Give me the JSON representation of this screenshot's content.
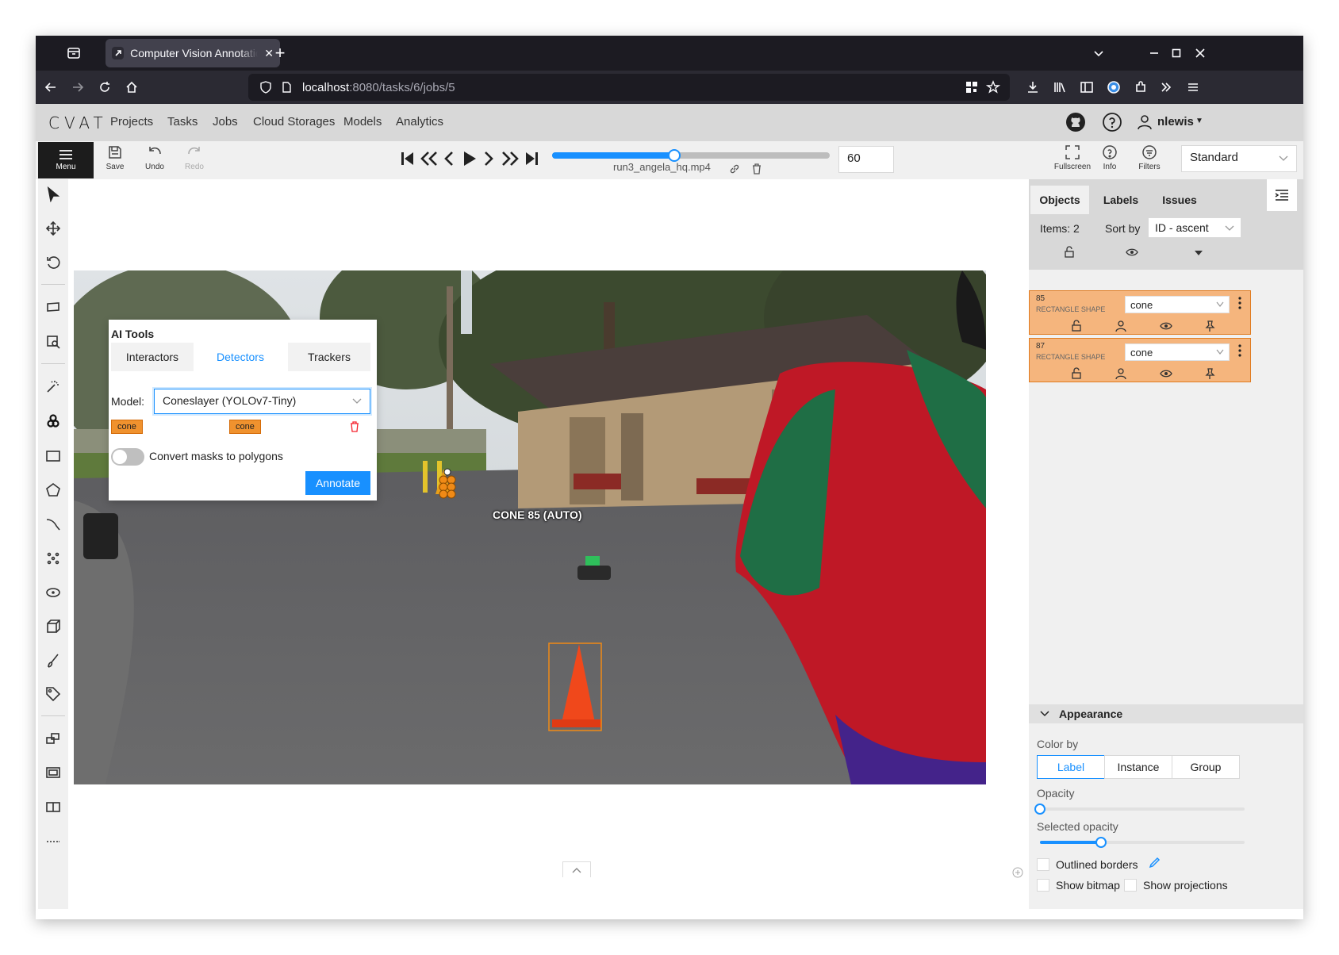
{
  "browser": {
    "tab_title": "Computer Vision Annotation Tool",
    "url_host": "localhost",
    "url_rest": ":8080/tasks/6/jobs/5"
  },
  "header": {
    "logo": "CVAT",
    "nav": [
      "Projects",
      "Tasks",
      "Jobs",
      "Cloud Storages",
      "Models",
      "Analytics"
    ],
    "username": "nlewis"
  },
  "toolbar": {
    "menu_label": "Menu",
    "save_label": "Save",
    "undo_label": "Undo",
    "redo_label": "Redo",
    "filename": "run3_angela_hq.mp4",
    "frame_number": "60",
    "frame_progress": 0.44,
    "fullscreen_label": "Fullscreen",
    "info_label": "Info",
    "filters_label": "Filters",
    "workspace": "Standard"
  },
  "canvas": {
    "cone_label": "CONE 85 (AUTO)"
  },
  "ai_tools": {
    "title": "AI Tools",
    "tabs": [
      "Interactors",
      "Detectors",
      "Trackers"
    ],
    "active_tab": "Detectors",
    "model_label": "Model:",
    "model_value": "Coneslayer (YOLOv7-Tiny)",
    "mapping_from": "cone",
    "mapping_to": "cone",
    "convert_label": "Convert masks to polygons",
    "convert_enabled": false,
    "annotate_label": "Annotate"
  },
  "sidebar": {
    "tabs": [
      "Objects",
      "Labels",
      "Issues"
    ],
    "active_tab": "Objects",
    "items_count": "Items: 2",
    "sort_label": "Sort by",
    "sort_value": "ID - ascent",
    "objects": [
      {
        "id": "85",
        "type": "RECTANGLE SHAPE",
        "label": "cone"
      },
      {
        "id": "87",
        "type": "RECTANGLE SHAPE",
        "label": "cone"
      }
    ],
    "object_color": "#f5b57d",
    "appearance": {
      "title": "Appearance",
      "color_by_label": "Color by",
      "color_by_options": [
        "Label",
        "Instance",
        "Group"
      ],
      "color_by_selected": "Label",
      "opacity_label": "Opacity",
      "opacity_value": 0,
      "selected_opacity_label": "Selected opacity",
      "selected_opacity_value": 0.3,
      "outlined_borders_label": "Outlined borders",
      "show_bitmap_label": "Show bitmap",
      "show_projections_label": "Show projections"
    }
  },
  "accent_color": "#1890ff"
}
